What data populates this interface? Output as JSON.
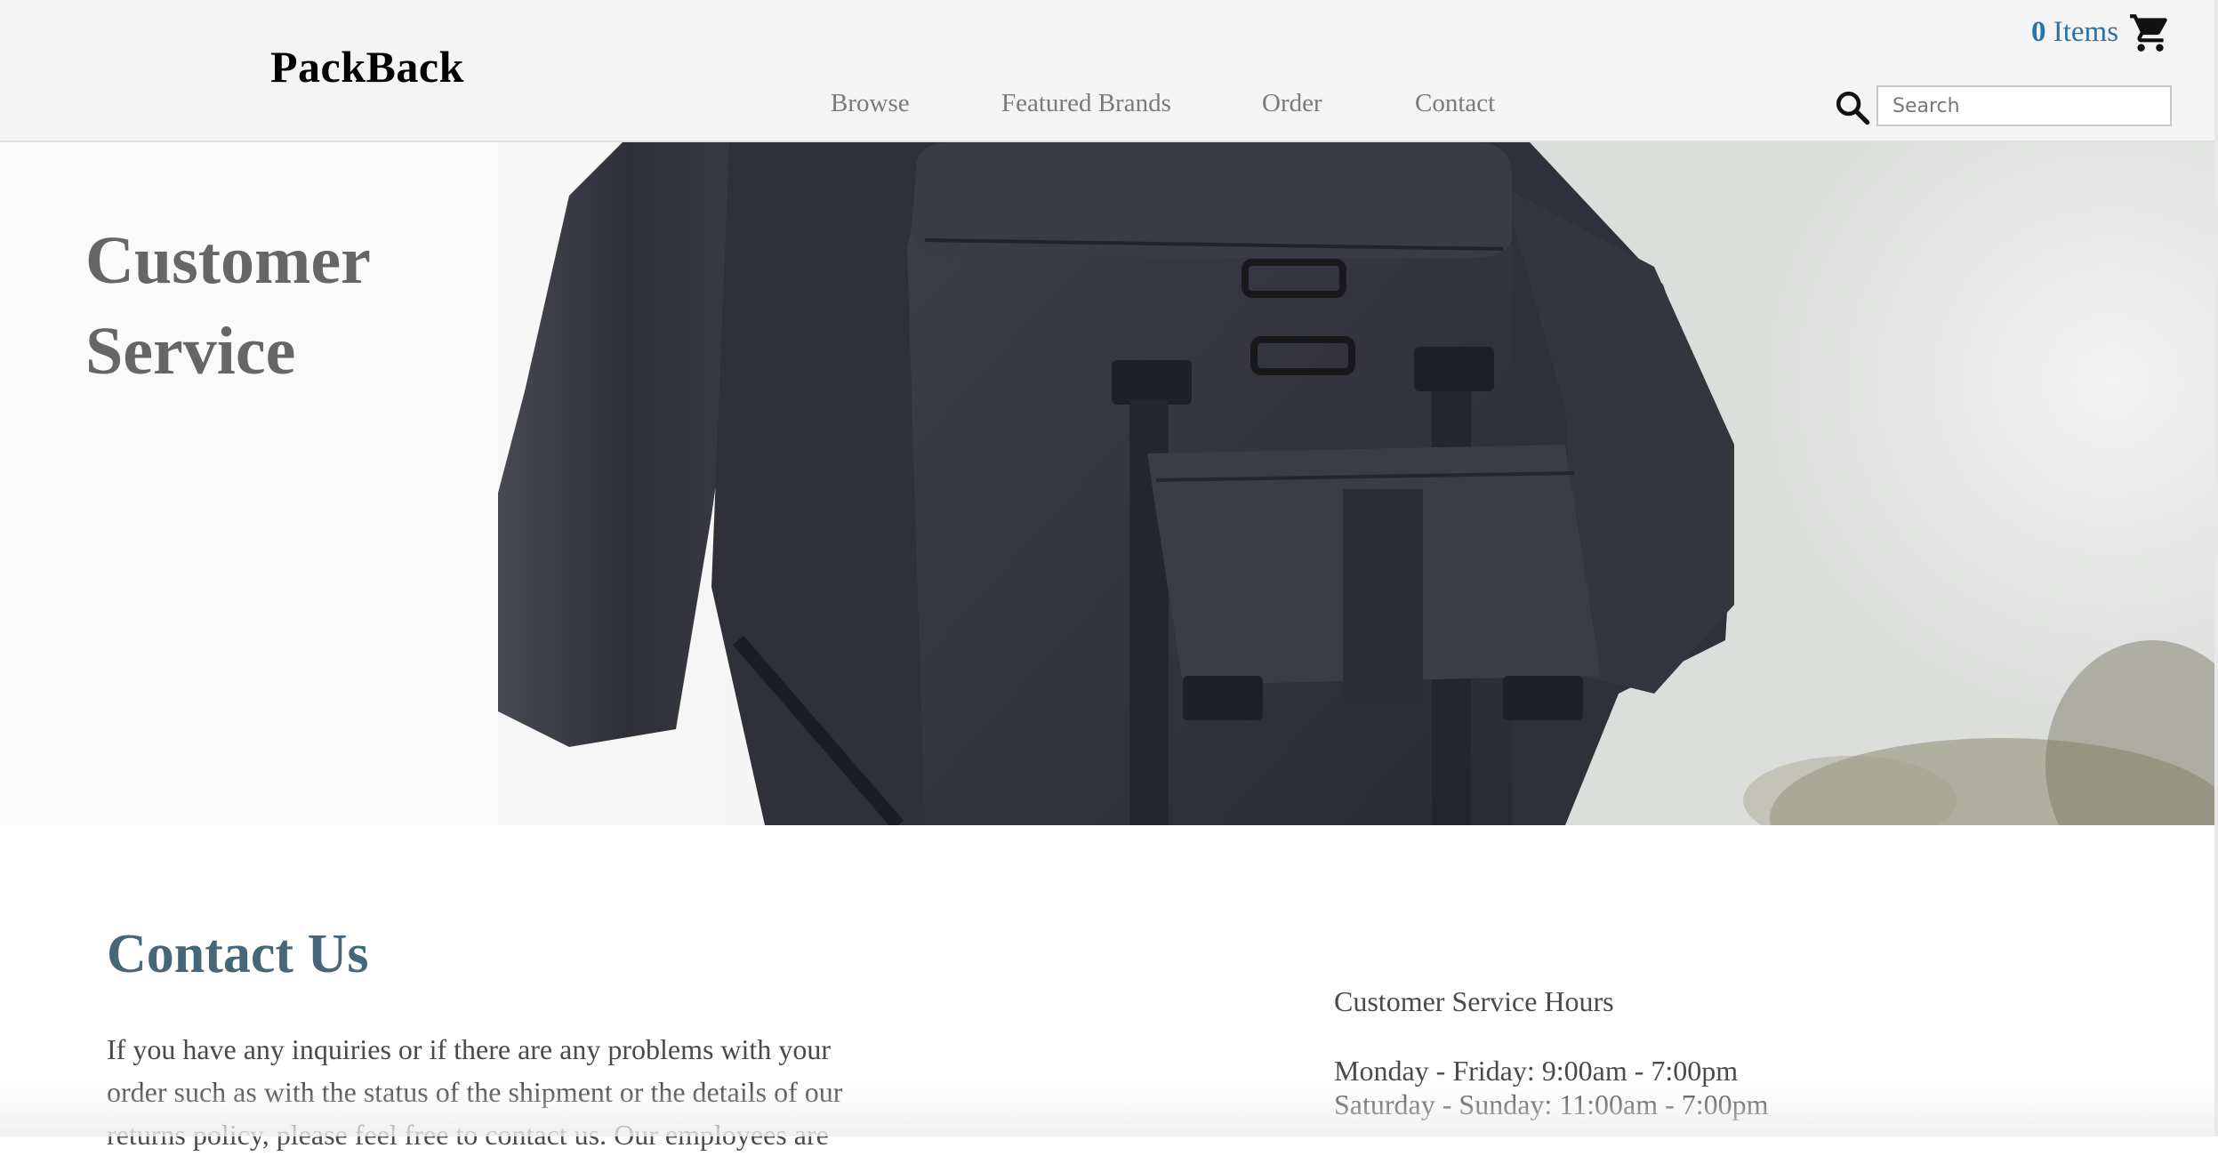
{
  "header": {
    "logo": "PackBack",
    "nav": [
      "Browse",
      "Featured Brands",
      "Order",
      "Contact"
    ],
    "cart": {
      "count": "0",
      "label": "Items",
      "icon": "shopping-cart-icon"
    },
    "search": {
      "placeholder": "Search",
      "value": "",
      "icon": "search-icon"
    }
  },
  "hero": {
    "title_line1": "Customer",
    "title_line2": "Service"
  },
  "contact": {
    "heading": "Contact Us",
    "text": "If you have any inquiries or if there are any problems with your order such as with the status of the shipment or the details of our returns policy, please feel free to contact us. Our employees are"
  },
  "hours": {
    "heading": "Customer Service Hours",
    "weekdays": "Monday - Friday: 9:00am - 7:00pm",
    "weekend": "Saturday - Sunday: 11:00am - 7:00pm"
  },
  "colors": {
    "accent_link": "#2a73a8",
    "heading_blue": "#476779",
    "header_bg": "#f4f4f4"
  }
}
